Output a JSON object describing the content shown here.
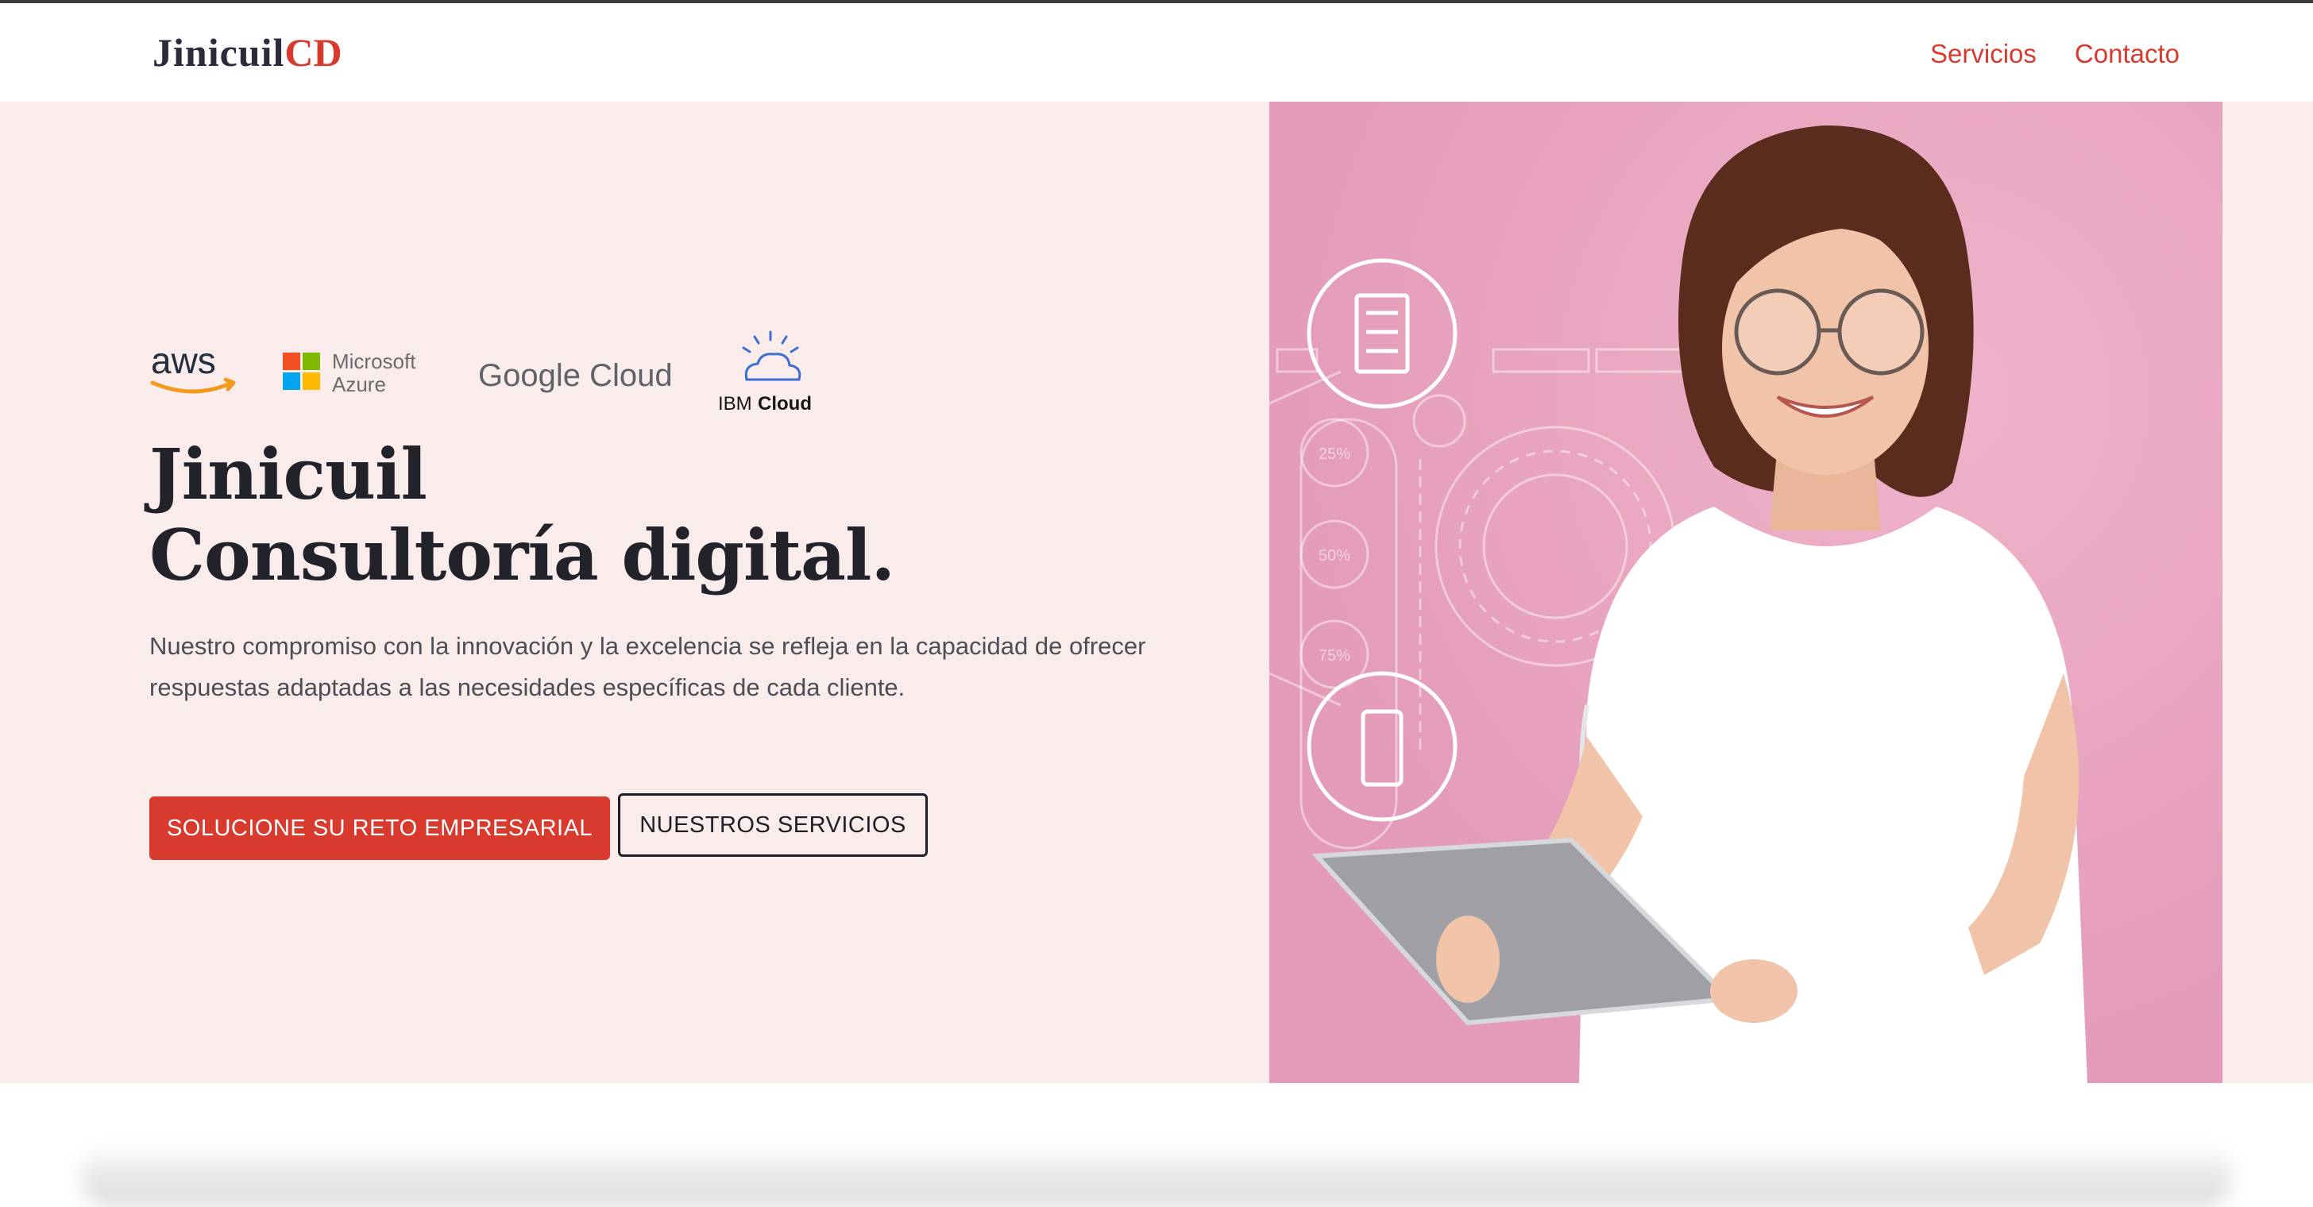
{
  "header": {
    "brand_main": "Jinicuil",
    "brand_accent": "CD",
    "nav": [
      {
        "label": "Servicios"
      },
      {
        "label": "Contacto"
      }
    ]
  },
  "hero": {
    "partners": [
      {
        "name": "aws",
        "icon": "aws-logo"
      },
      {
        "name": "Microsoft",
        "name2": "Azure",
        "icon": "microsoft-azure-logo"
      },
      {
        "name": "Google Cloud",
        "icon": "google-cloud-logo"
      },
      {
        "name": "IBM",
        "name2": "Cloud",
        "icon": "ibm-cloud-logo"
      }
    ],
    "title_line1": "Jinicuil",
    "title_line2": "Consultoría digital.",
    "description": "Nuestro compromiso con la innovación y la excelencia se refleja en la capacidad de ofrecer respuestas adaptadas a las necesidades específicas de cada cliente.",
    "primary_cta": "SOLUCIONE SU RETO EMPRESARIAL",
    "secondary_cta": "NUESTROS SERVICIOS",
    "image_overlay_labels": [
      "25%",
      "50%",
      "75%"
    ]
  },
  "colors": {
    "accent": "#d93a2e",
    "hero_bg": "#fbecec",
    "image_bg": "#e6a2bd",
    "text_dark": "#22222a"
  }
}
